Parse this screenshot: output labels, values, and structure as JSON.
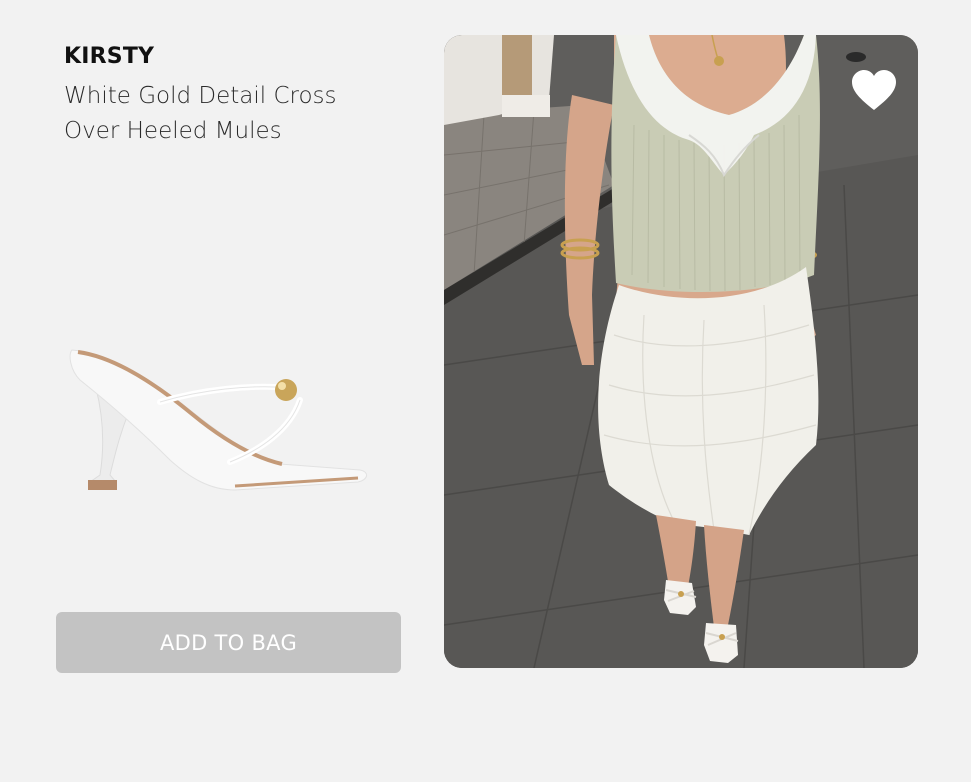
{
  "product": {
    "brand": "KIRSTY",
    "name": "White Gold Detail Cross Over Heeled Mules"
  },
  "actions": {
    "add_to_bag_label": "ADD TO BAG"
  },
  "icons": {
    "wishlist": "heart-icon"
  },
  "colors": {
    "page_background": "#f2f2f2",
    "button_background": "#c3c3c3",
    "button_text": "#ffffff",
    "heart": "#ffffff"
  }
}
